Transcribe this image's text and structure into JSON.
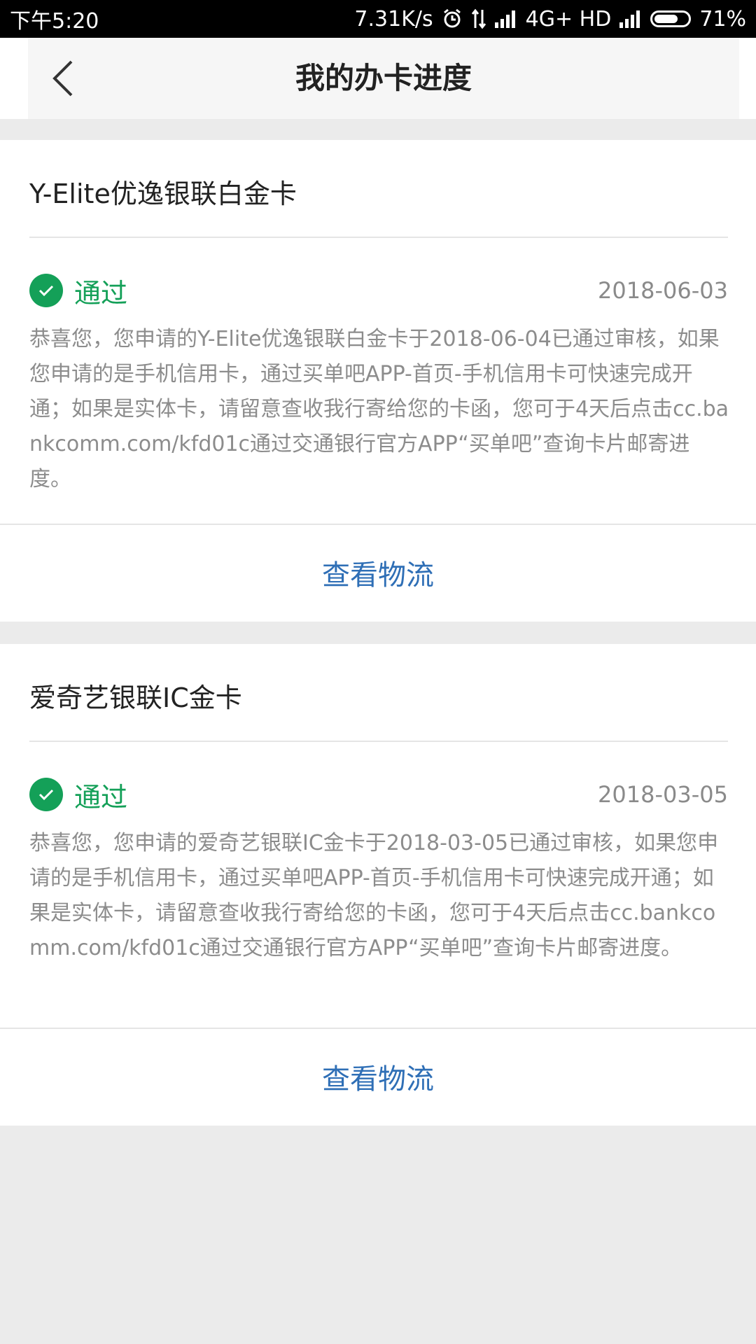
{
  "status_bar": {
    "time": "下午5:20",
    "speed": "7.31K/s",
    "network": "4G+ HD",
    "battery": "71%",
    "battery_level": 0.71
  },
  "header": {
    "title": "我的办卡进度"
  },
  "cards": [
    {
      "name": "Y-Elite优逸银联白金卡",
      "status": "通过",
      "date": "2018-06-03",
      "description": "恭喜您，您申请的Y-Elite优逸银联白金卡于2018-06-04已通过审核，如果您申请的是手机信用卡，通过买单吧APP-首页-手机信用卡可快速完成开通；如果是实体卡，请留意查收我行寄给您的卡函，您可于4天后点击cc.bankcomm.com/kfd01c通过交通银行官方APP“买单吧”查询卡片邮寄进度。",
      "action": "查看物流"
    },
    {
      "name": "爱奇艺银联IC金卡",
      "status": "通过",
      "date": "2018-03-05",
      "description": "恭喜您，您申请的爱奇艺银联IC金卡于2018-03-05已通过审核，如果您申请的是手机信用卡，通过买单吧APP-首页-手机信用卡可快速完成开通；如果是实体卡，请留意查收我行寄给您的卡函，您可于4天后点击cc.bankcomm.com/kfd01c通过交通银行官方APP“买单吧”查询卡片邮寄进度。",
      "action": "查看物流"
    }
  ],
  "colors": {
    "status_green": "#14a058",
    "link_blue": "#2f6fb6",
    "background": "#ebebeb"
  }
}
